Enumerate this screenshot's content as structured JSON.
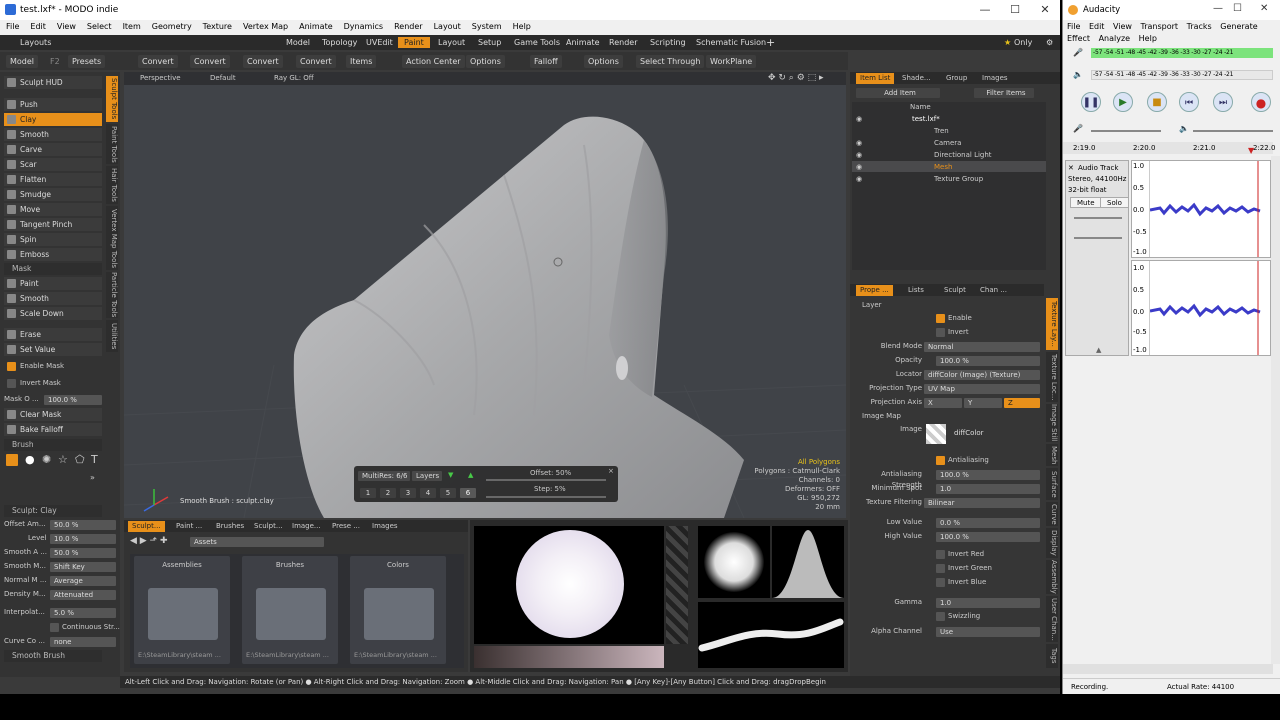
{
  "modo": {
    "title": "test.lxf* - MODO indie",
    "menu": [
      "File",
      "Edit",
      "View",
      "Select",
      "Item",
      "Geometry",
      "Texture",
      "Vertex Map",
      "Animate",
      "Dynamics",
      "Render",
      "Layout",
      "System",
      "Help"
    ],
    "layouts_label": "Layouts",
    "layout_tabs": [
      "Model",
      "Topology",
      "UVEdit",
      "Paint",
      "Layout",
      "Setup",
      "Game Tools",
      "Animate",
      "Render",
      "Scripting",
      "Schematic Fusion"
    ],
    "active_layout": "Paint",
    "add_tab": "+",
    "only_label": "Only",
    "toolbar": {
      "model": "Model",
      "f2": "F2",
      "presets": "Presets",
      "convert": "Convert",
      "items": "Items",
      "action_center": "Action Center",
      "options": "Options",
      "falloff": "Falloff",
      "select_through": "Select Through",
      "workplane": "WorkPlane"
    },
    "left": {
      "sculpt_hud": "Sculpt HUD",
      "tools": [
        "Push",
        "Clay",
        "Smooth",
        "Carve",
        "Scar",
        "Flatten",
        "Smudge",
        "Move",
        "Tangent Pinch",
        "Spin",
        "Emboss"
      ],
      "active_tool": "Clay",
      "mask_header": "Mask",
      "mask_tools": [
        "Paint",
        "Smooth",
        "Scale Down"
      ],
      "erase": "Erase",
      "set_value": "Set Value",
      "enable_mask": "Enable Mask",
      "invert_mask": "Invert Mask",
      "mask_opacity_label": "Mask O ...",
      "mask_opacity": "100.0 %",
      "clear_mask": "Clear Mask",
      "bake_falloff": "Bake Falloff",
      "brush_header": "Brush",
      "sculpt_clay": "Sculpt: Clay",
      "props": [
        {
          "label": "Offset Am...",
          "value": "50.0 %"
        },
        {
          "label": "Level",
          "value": "10.0 %"
        },
        {
          "label": "Smooth A ...",
          "value": "50.0 %"
        },
        {
          "label": "Smooth M...",
          "value": "Shift Key"
        },
        {
          "label": "Normal M ...",
          "value": "Average"
        },
        {
          "label": "Density M...",
          "value": "Attenuated"
        },
        {
          "label": "Interpolat...",
          "value": "5.0 %"
        }
      ],
      "continuous": "Continuous Str...",
      "curve_label": "Curve Co ...",
      "curve_value": "none",
      "smooth_brush": "Smooth Brush",
      "vtabs": [
        "Sculpt Tools",
        "Paint Tools",
        "Hair Tools",
        "Vertex Map Tools",
        "Particle Tools",
        "Utilities"
      ]
    },
    "viewport": {
      "perspective": "Perspective",
      "default": "Default",
      "raygl": "Ray GL: Off",
      "stats": [
        "All Polygons",
        "Polygons : Catmull-Clark",
        "Channels: 0",
        "Deformers: OFF",
        "GL: 950,272",
        "20 mm"
      ],
      "brush_info": "Smooth Brush : sculpt.clay",
      "multires": "MultiRes: 6/6",
      "layers": "Layers",
      "levels": [
        "1",
        "2",
        "3",
        "4",
        "5",
        "6"
      ],
      "offset": "Offset: 50%",
      "step": "Step: 5%"
    },
    "assets": {
      "tabs": [
        "Sculpt...",
        "Paint ...",
        "Brushes",
        "Sculpt...",
        "Image...",
        "Prese ...",
        "Images"
      ],
      "path": "Assets",
      "folders": [
        {
          "name": "Assemblies",
          "path": "E:\\SteamLibrary\\steam ..."
        },
        {
          "name": "Brushes",
          "path": "E:\\SteamLibrary\\steam ..."
        },
        {
          "name": "Colors",
          "path": "E:\\SteamLibrary\\steam ..."
        }
      ]
    },
    "items": {
      "tabs": [
        "Item List",
        "Shade...",
        "Group",
        "Images"
      ],
      "add_item": "Add Item",
      "filter": "Filter Items",
      "name_col": "Name",
      "tree": [
        "test.lxf*",
        "Tren",
        "Camera",
        "Directional Light",
        "Mesh",
        "Texture Group"
      ]
    },
    "props": {
      "tabs": [
        "Prope ...",
        "Lists",
        "Sculpt",
        "Chan ..."
      ],
      "layer_header": "Layer",
      "enable": "Enable",
      "invert": "Invert",
      "rows": [
        {
          "label": "Blend Mode",
          "value": "Normal"
        },
        {
          "label": "Opacity",
          "value": "100.0 %"
        },
        {
          "label": "Locator",
          "value": "diffColor (Image) (Texture)"
        },
        {
          "label": "Projection Type",
          "value": "UV Map"
        }
      ],
      "axis_label": "Projection Axis",
      "axes": [
        "X",
        "Y",
        "Z"
      ],
      "image_map_header": "Image Map",
      "image_label": "Image",
      "image_value": "diffColor",
      "antialiasing": "Antialiasing",
      "rows2": [
        {
          "label": "Antialiasing Strength",
          "value": "100.0 %"
        },
        {
          "label": "Minimum Spot",
          "value": "1.0"
        },
        {
          "label": "Texture Filtering",
          "value": "Bilinear"
        },
        {
          "label": "Low Value",
          "value": "0.0 %"
        },
        {
          "label": "High Value",
          "value": "100.0 %"
        }
      ],
      "invert_red": "Invert Red",
      "invert_green": "Invert Green",
      "invert_blue": "Invert Blue",
      "gamma_label": "Gamma",
      "gamma": "1.0",
      "swizzling": "Swizzling",
      "alpha_label": "Alpha Channel",
      "alpha": "Use",
      "vtabs": [
        "Texture Lay...",
        "Texture Loc...",
        "Image Still",
        "Mesh",
        "Surface",
        "Curve",
        "Display",
        "Assembly",
        "User Chan...",
        "Tags"
      ]
    },
    "status": "Alt-Left Click and Drag: Navigation: Rotate (or Pan) ●  Alt-Right Click and Drag: Navigation: Zoom ●  Alt-Middle Click and Drag: Navigation: Pan ●  [Any Key]-[Any Button] Click and Drag: dragDropBegin"
  },
  "audacity": {
    "title": "Audacity",
    "menu1": [
      "File",
      "Edit",
      "View",
      "Transport",
      "Tracks",
      "Generate"
    ],
    "menu2": [
      "Effect",
      "Analyze",
      "Help"
    ],
    "meter": [
      "-57",
      "-54",
      "-51",
      "-48",
      "-45",
      "-42",
      "-39",
      "-36",
      "-33",
      "-30",
      "-27",
      "-24",
      "-21"
    ],
    "timeline": [
      "2:19.0",
      "2:20.0",
      "2:21.0",
      "2:22.0"
    ],
    "track_name": "Audio Track",
    "track_info": [
      "Stereo, 44100Hz",
      "32-bit float"
    ],
    "mute": "Mute",
    "solo": "Solo",
    "scale": [
      "1.0",
      "0.5",
      "0.0",
      "-0.5",
      "-1.0"
    ],
    "status_left": "Recording.",
    "status_right": "Actual Rate: 44100"
  },
  "colors": {
    "accent": "#e8901a",
    "viewport": "#404348",
    "panel": "#363636"
  }
}
